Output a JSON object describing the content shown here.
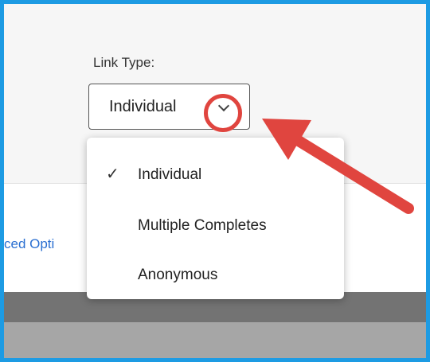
{
  "link_type": {
    "label": "Link Type:",
    "selected_value": "Individual",
    "options": [
      {
        "label": "Individual",
        "selected": true
      },
      {
        "label": "Multiple Completes",
        "selected": false
      },
      {
        "label": "Anonymous",
        "selected": false
      }
    ],
    "check_glyph": "✓"
  },
  "side_link": {
    "text": "ced Opti"
  },
  "icons": {
    "dropdown": "chevron-down-icon",
    "check": "checkmark-icon"
  },
  "colors": {
    "frame_border": "#1d9be3",
    "annotation_red": "#e0453f",
    "link": "#2a6fd1"
  }
}
